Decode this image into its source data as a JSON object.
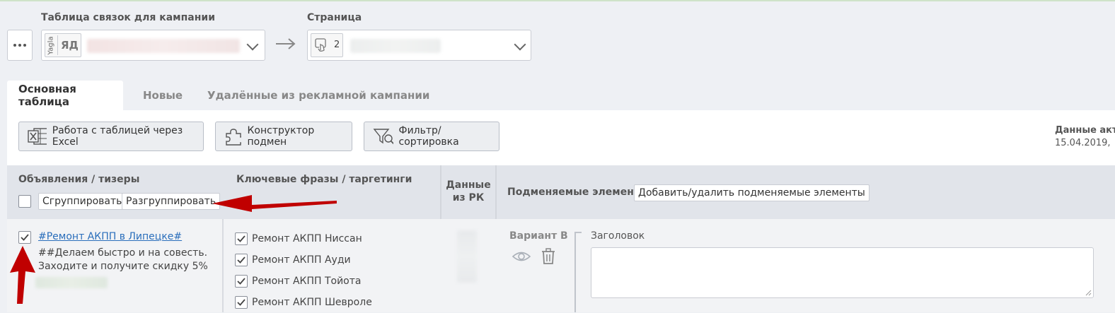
{
  "top": {
    "campaign_label": "Таблица связок для кампании",
    "yagla_text": "Yagla",
    "yd_text": "ЯД",
    "page_label": "Страница",
    "page_count": "2"
  },
  "tabs": [
    "Основная таблица",
    "Новые",
    "Удалённые из рекламной кампании"
  ],
  "toolbar": {
    "excel": "Работа с таблицей через Excel",
    "constructor": "Конструктор подмен",
    "filter": "Фильтр/сортировка",
    "updated_label": "Данные акту",
    "updated_date": "15.04.2019,"
  },
  "table": {
    "col_ads": "Объявления / тизеры",
    "group": "Сгруппировать",
    "ungroup": "Разгруппировать",
    "col_keywords": "Ключевые фразы / таргетинги",
    "col_data_1": "Данные",
    "col_data_2": "из РК",
    "col_replace": "Подменяемые элементы",
    "add_remove": "Добавить/удалить подменяемые элементы"
  },
  "row": {
    "ad_title": "#Ремонт АКПП в Липецке#",
    "ad_text_1": "##Делаем быстро и на совесть.",
    "ad_text_2": "Заходите и получите скидку 5%",
    "keywords": [
      "Ремонт АКПП Ниссан",
      "Ремонт АКПП Ауди",
      "Ремонт АКПП Тойота",
      "Ремонт АКПП Шевроле"
    ],
    "variant": "Вариант В",
    "headline_label": "Заголовок"
  },
  "colors": {
    "arrow": "#c00000",
    "link": "#2a6ebb"
  }
}
